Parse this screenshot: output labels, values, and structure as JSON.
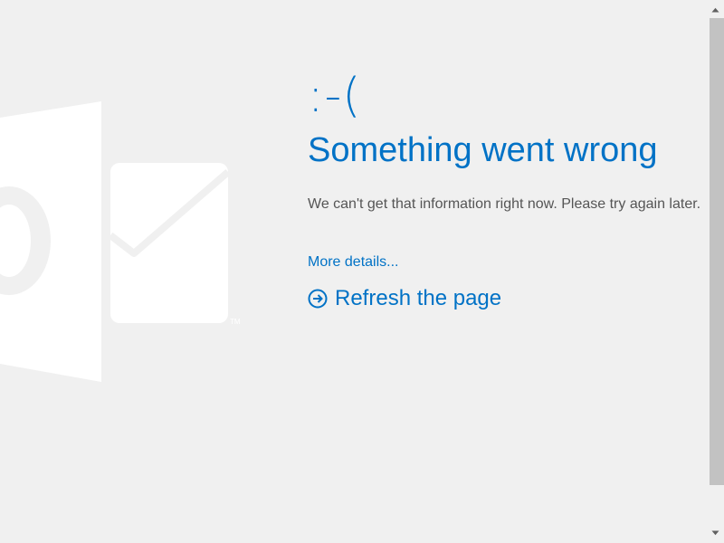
{
  "error": {
    "face": ":-(",
    "heading": "Something went wrong",
    "message": "We can't get that information right now. Please try again later.",
    "details_link": "More details...",
    "refresh_label": "Refresh the page"
  },
  "logo": {
    "trademark": "TM"
  },
  "colors": {
    "accent": "#0072c6",
    "background": "#f0f0f0",
    "text": "#555555",
    "scroll_thumb": "#c2c2c2"
  },
  "icons": {
    "logo": "outlook-logo-icon",
    "refresh": "arrow-circle-right-icon",
    "scroll_up": "chevron-up-icon",
    "scroll_down": "chevron-down-icon"
  }
}
